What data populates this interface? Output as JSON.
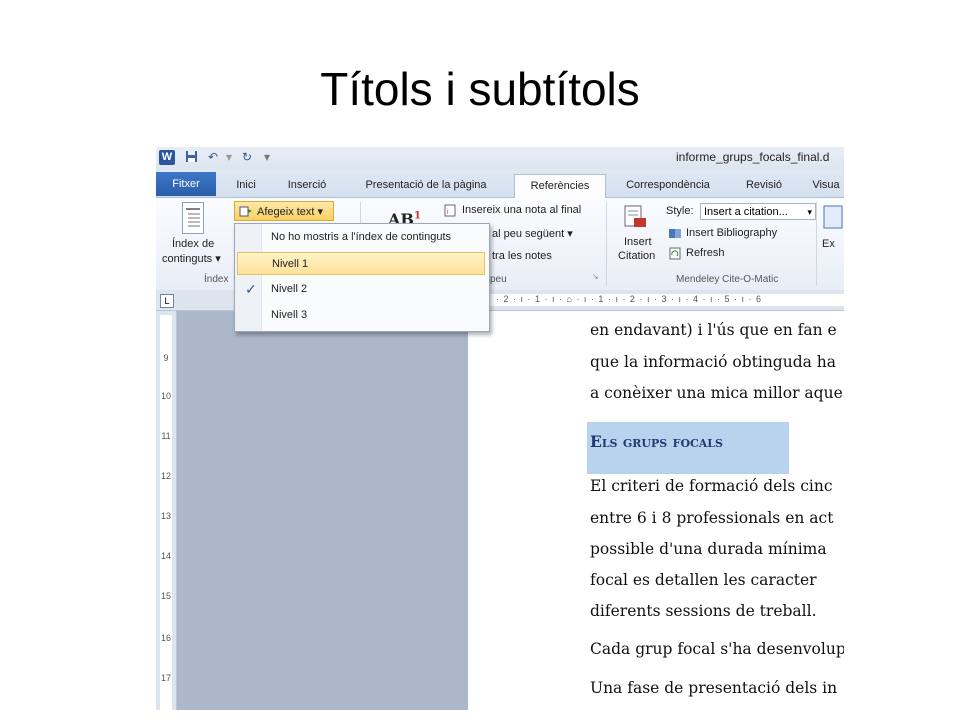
{
  "slide": {
    "title": "Títols i subtítols"
  },
  "window": {
    "title": "informe_grups_focals_final.d",
    "app_icon_letter": "W"
  },
  "tabs": [
    "Fitxer",
    "Inici",
    "Inserció",
    "Presentació de la pàgina",
    "Referències",
    "Correspondència",
    "Revisió",
    "Visua"
  ],
  "active_tab": "Referències",
  "ribbon": {
    "toc_button_line1": "Índex de",
    "toc_button_line2": "continguts ▾",
    "toc_group_label": "Índex",
    "add_text_label": "Afegeix text ▾",
    "footnote_icon_text": "AB",
    "footnote_superscript": "1",
    "insert_endnote": "Insereix una nota al final",
    "next_footnote": "al peu següent ▾",
    "show_notes": "tra les notes",
    "footnotes_group_label": "peu",
    "insert_citation_line1": "Insert",
    "insert_citation_line2": "Citation",
    "style_label": "Style:",
    "style_value": "Insert a citation...",
    "insert_bibliography": "Insert Bibliography",
    "refresh": "Refresh",
    "mendeley_group_label": "Mendeley Cite-O-Matic",
    "export_label": "Ex"
  },
  "menu": {
    "items": [
      "No ho mostris a l'índex de continguts",
      "Nivell 1",
      "Nivell 2",
      "Nivell 3"
    ],
    "highlighted": "Nivell 1",
    "checked": "Nivell 2",
    "check_glyph": "✓"
  },
  "ruler": {
    "top_marks": "· 2 · ı · 1 · ı · ⌂ · ı · 1 · ı · 2 · ı · 3 · ı · 4 · ı · 5 · ı · 6",
    "corner_glyph": "L",
    "left_numbers": [
      "9",
      "10",
      "11",
      "12",
      "13",
      "14",
      "15",
      "16",
      "17"
    ]
  },
  "document": {
    "lines_top": [
      "en endavant) i l'ús que en fan e",
      "que la informació obtinguda ha",
      "a conèixer una mica millor aque"
    ],
    "heading": "Els grups focals",
    "lines_bottom": [
      "El criteri de formació dels cinc",
      "entre 6 i 8 professionals en act",
      "possible d'una durada mínima",
      "focal es detallen les caracter",
      "diferents sessions de treball.",
      "Cada grup focal s'ha desenvolup",
      "Una fase de presentació dels in"
    ]
  },
  "colors": {
    "file_tab": "#2a5ea9",
    "highlight_heading": "#b9d3ee",
    "menu_highlight": "#fde39a"
  }
}
